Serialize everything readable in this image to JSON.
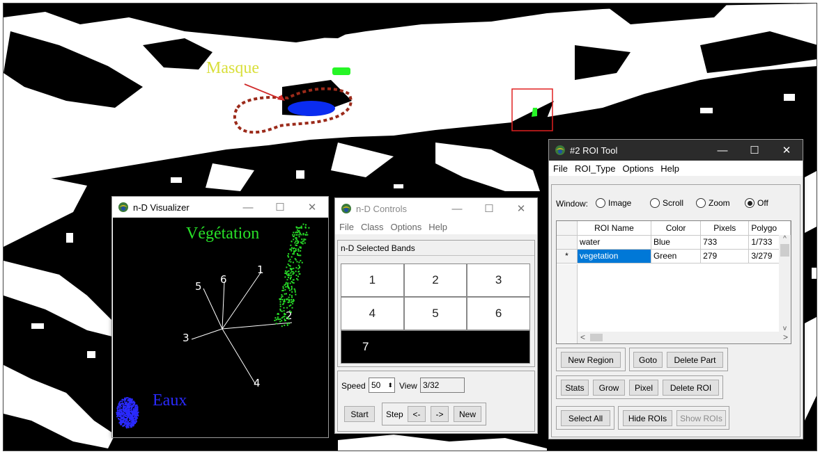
{
  "map": {
    "masque_label": "Masque",
    "colors": {
      "background": "#000000",
      "water_mask": "#ffffff",
      "roi_water": "#0a2cf0",
      "roi_vegetation": "#26f526",
      "mask_outline": "#9b2a1a",
      "highlight_box": "#e02020"
    }
  },
  "nd_visualizer": {
    "title": "n-D Visualizer",
    "label_vegetation": "Végétation",
    "label_water": "Eaux",
    "axes": [
      "1",
      "2",
      "3",
      "4",
      "5",
      "6"
    ],
    "colors": {
      "vegetation": "#28e028",
      "water": "#2a2aff"
    }
  },
  "nd_controls": {
    "title": "n-D Controls",
    "menu": [
      "File",
      "Class",
      "Options",
      "Help"
    ],
    "bands_title": "n-D Selected Bands",
    "bands": [
      "1",
      "2",
      "3",
      "4",
      "5",
      "6",
      "7"
    ],
    "speed_label": "Speed",
    "speed_value": "50",
    "view_label": "View",
    "view_value": "3/32",
    "start_label": "Start",
    "step_label": "Step",
    "prev_label": "<-",
    "next_label": "->",
    "new_label": "New"
  },
  "roi_tool": {
    "title": "#2 ROI Tool",
    "menu": [
      "File",
      "ROI_Type",
      "Options",
      "Help"
    ],
    "window_label": "Window:",
    "radio": {
      "image": "Image",
      "scroll": "Scroll",
      "zoom": "Zoom",
      "off": "Off",
      "selected": "Off"
    },
    "columns": {
      "name": "ROI Name",
      "color": "Color",
      "pixels": "Pixels",
      "polygons": "Polygo"
    },
    "rows": [
      {
        "marker": "",
        "name": "water",
        "color": "Blue",
        "pixels": "733",
        "polygons": "1/733"
      },
      {
        "marker": "*",
        "name": "vegetation",
        "color": "Green",
        "pixels": "279",
        "polygons": "3/279"
      }
    ],
    "buttons": {
      "new_region": "New Region",
      "goto": "Goto",
      "delete_part": "Delete Part",
      "stats": "Stats",
      "grow": "Grow",
      "pixel": "Pixel",
      "delete_roi": "Delete ROI",
      "select_all": "Select All",
      "hide_rois": "Hide ROIs",
      "show_rois": "Show ROIs"
    }
  },
  "window_buttons": {
    "minimize": "—",
    "maximize": "☐",
    "close": "✕"
  }
}
